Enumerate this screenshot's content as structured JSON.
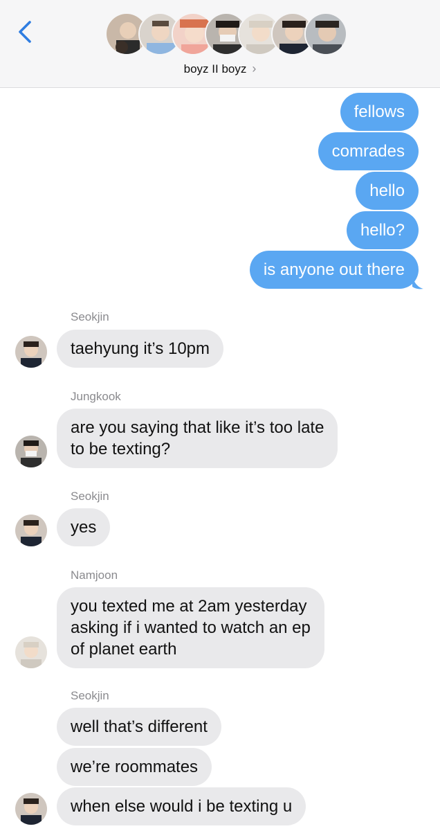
{
  "header": {
    "group_name": "boyz II boyz",
    "back_icon": "chevron-left-icon",
    "disclosure_icon": "chevron-right-icon",
    "member_avatars": 7
  },
  "colors": {
    "outgoing_bubble": "#5aa7f2",
    "incoming_bubble": "#e9e9eb",
    "header_bg": "#f6f6f7",
    "back_button": "#2f7de1"
  },
  "outgoing": [
    {
      "text": "fellows"
    },
    {
      "text": "comrades"
    },
    {
      "text": "hello"
    },
    {
      "text": "hello?"
    },
    {
      "text": "is anyone out there"
    }
  ],
  "incoming": [
    {
      "sender": "Seokjin",
      "lines": [
        "taehyung it’s 10pm"
      ]
    },
    {
      "sender": "Jungkook",
      "lines": [
        "are you saying that like it’s too late",
        "to be texting?"
      ]
    },
    {
      "sender": "Seokjin",
      "lines": [
        "yes"
      ]
    },
    {
      "sender": "Namjoon",
      "lines": [
        "you texted me at 2am yesterday",
        "asking if i wanted to watch an ep",
        "of planet earth"
      ]
    },
    {
      "sender": "Seokjin",
      "lines": [
        "well that’s different"
      ]
    },
    {
      "sender": "",
      "lines": [
        "we’re roommates"
      ]
    },
    {
      "sender": "",
      "lines": [
        "when else would i be texting u"
      ]
    }
  ]
}
